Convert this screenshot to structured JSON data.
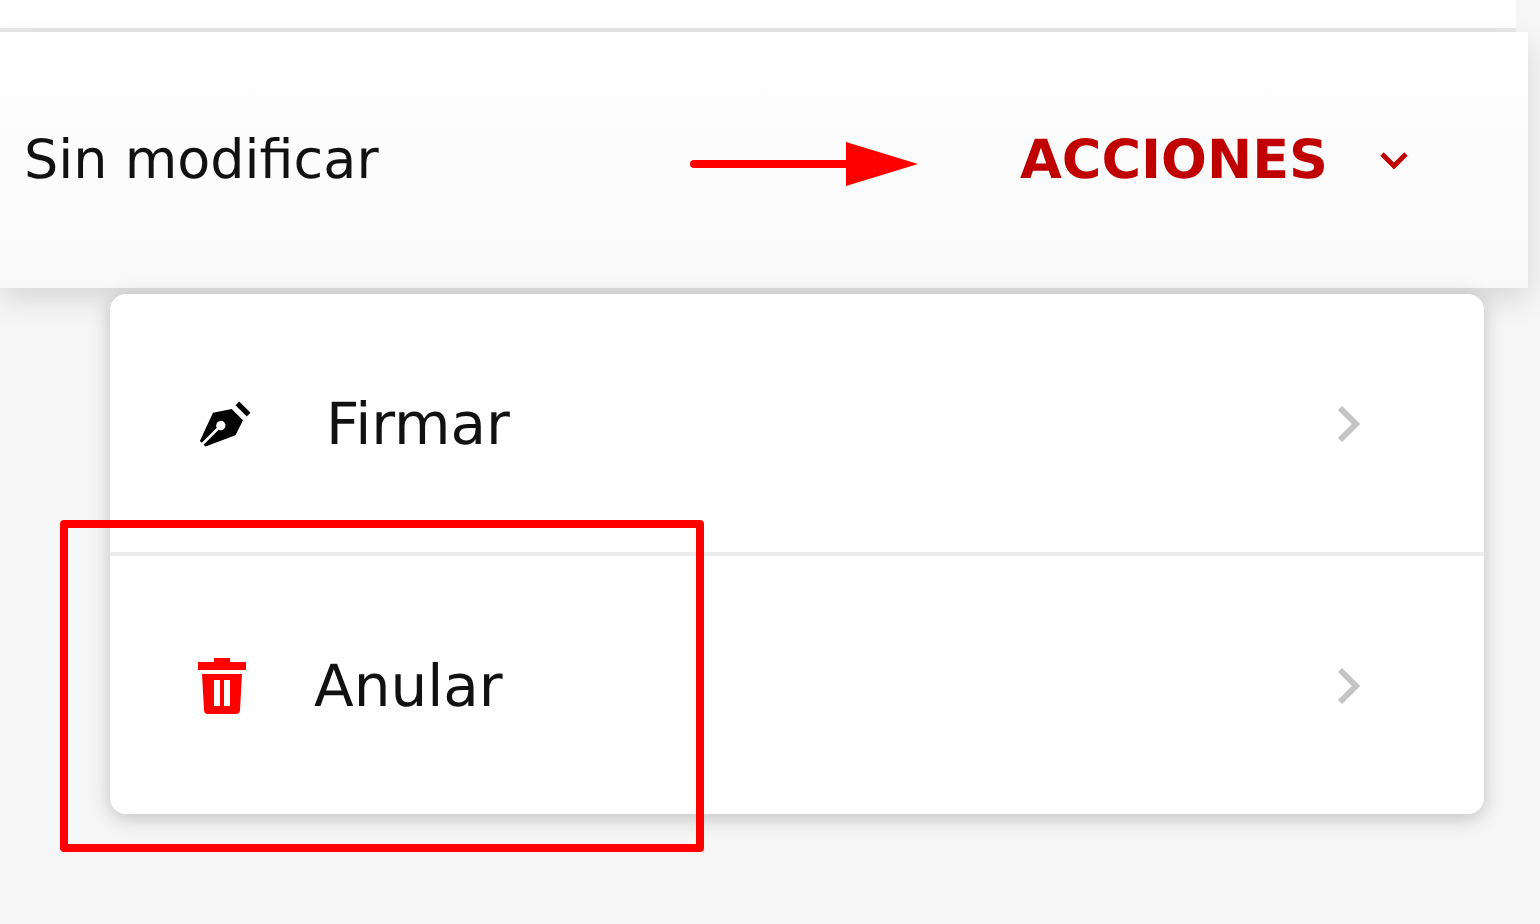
{
  "row": {
    "status": "Sin modificar",
    "actions_button": {
      "label": "ACCIONES",
      "expanded": true
    }
  },
  "menu": {
    "items": [
      {
        "kind": "sign",
        "label": "Firmar"
      },
      {
        "kind": "void",
        "label": "Anular"
      }
    ]
  },
  "annotations": {
    "arrow": true,
    "highlight_box": true
  }
}
